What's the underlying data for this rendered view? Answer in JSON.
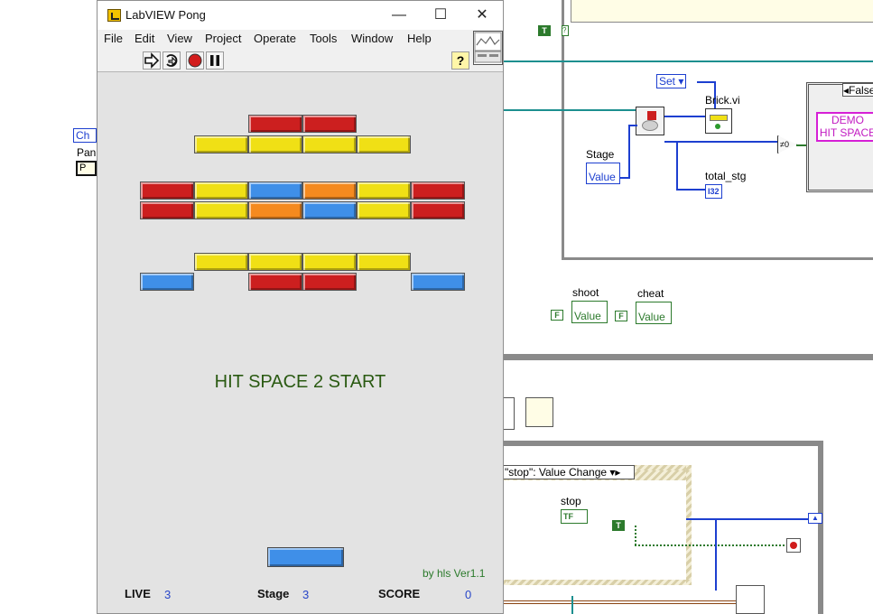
{
  "window": {
    "title": "LabVIEW Pong",
    "controls": {
      "minimize": "—",
      "maximize": "☐",
      "close": "✕"
    }
  },
  "menu": [
    "File",
    "Edit",
    "View",
    "Project",
    "Operate",
    "Tools",
    "Window",
    "Help"
  ],
  "toolbar": {
    "buttons": [
      "run-arrow-icon",
      "run-continuous-icon",
      "abort-icon",
      "pause-icon"
    ],
    "help": "?"
  },
  "game": {
    "message": "HIT SPACE 2 START",
    "credit": "by hls Ver1.1",
    "stats": {
      "live_label": "LIVE",
      "live_value": "3",
      "stage_label": "Stage",
      "stage_value": "3",
      "score_label": "SCORE",
      "score_value": "0"
    },
    "colors": {
      "red": "#cc1f1f",
      "yellow": "#f0e015",
      "blue": "#3f8fe8",
      "orange": "#f58a1f"
    },
    "bricks": [
      {
        "row": 0,
        "col": 2,
        "color": "red"
      },
      {
        "row": 0,
        "col": 3,
        "color": "red"
      },
      {
        "row": 1,
        "col": 1,
        "color": "yellow"
      },
      {
        "row": 1,
        "col": 2,
        "color": "yellow"
      },
      {
        "row": 1,
        "col": 3,
        "color": "yellow"
      },
      {
        "row": 1,
        "col": 4,
        "color": "yellow"
      },
      {
        "row": 3,
        "col": 0,
        "color": "red"
      },
      {
        "row": 3,
        "col": 1,
        "color": "yellow"
      },
      {
        "row": 3,
        "col": 2,
        "color": "blue"
      },
      {
        "row": 3,
        "col": 3,
        "color": "orange"
      },
      {
        "row": 3,
        "col": 4,
        "color": "yellow"
      },
      {
        "row": 3,
        "col": 5,
        "color": "red"
      },
      {
        "row": 4,
        "col": 0,
        "color": "red"
      },
      {
        "row": 4,
        "col": 1,
        "color": "yellow"
      },
      {
        "row": 4,
        "col": 2,
        "color": "orange"
      },
      {
        "row": 4,
        "col": 3,
        "color": "blue"
      },
      {
        "row": 4,
        "col": 4,
        "color": "yellow"
      },
      {
        "row": 4,
        "col": 5,
        "color": "red"
      },
      {
        "row": 6,
        "col": 1,
        "color": "yellow"
      },
      {
        "row": 6,
        "col": 2,
        "color": "yellow"
      },
      {
        "row": 6,
        "col": 3,
        "color": "yellow"
      },
      {
        "row": 6,
        "col": 4,
        "color": "yellow"
      },
      {
        "row": 7,
        "col": 0,
        "color": "blue"
      },
      {
        "row": 7,
        "col": 2,
        "color": "red"
      },
      {
        "row": 7,
        "col": 3,
        "color": "red"
      },
      {
        "row": 7,
        "col": 5,
        "color": "blue"
      }
    ]
  },
  "block_diagram": {
    "set_label": "Set",
    "brick_vi": "Brick.vi",
    "stage_label": "Stage",
    "value_label": "Value",
    "total_stg": "total_stg",
    "i32": "I32",
    "shoot": "shoot",
    "cheat": "cheat",
    "false_label": "False",
    "demo_text": "DEMO",
    "hit_space_text": "HIT SPACE",
    "ch_label": "Ch",
    "pan_label": "Pan",
    "p_label": "P",
    "event_case": "\"stop\": Value Change",
    "stop_label": "stop",
    "tf": "TF",
    "t_const": "T",
    "f_const": "F",
    "not_equal": "≠0"
  }
}
